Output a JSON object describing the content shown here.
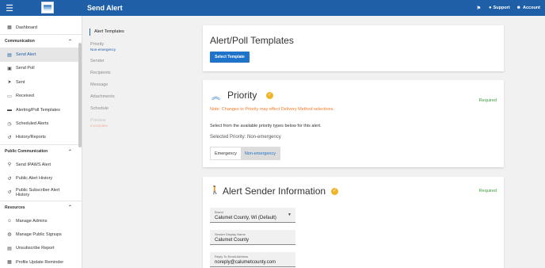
{
  "topbar": {
    "title": "Send Alert",
    "support_label": "Support",
    "account_label": "Account",
    "color": "#1f5fa8"
  },
  "sidebar": {
    "dashboard": "Dashboard",
    "sections": {
      "communication": "Communication",
      "public_communication": "Public Communication",
      "resources": "Resources"
    },
    "communication_items": [
      {
        "label": "Send Alert",
        "icon": "chat-icon"
      },
      {
        "label": "Send Poll",
        "icon": "poll-icon"
      },
      {
        "label": "Sent",
        "icon": "send-icon"
      },
      {
        "label": "Received",
        "icon": "inbox-icon"
      },
      {
        "label": "Alerting/Poll Templates",
        "icon": "folder-icon"
      },
      {
        "label": "Scheduled Alerts",
        "icon": "clock-icon"
      },
      {
        "label": "History/Reports",
        "icon": "history-icon"
      }
    ],
    "public_items": [
      {
        "label": "Send IPAWS Alert",
        "icon": "broadcast-icon"
      },
      {
        "label": "Public Alert History",
        "icon": "history-icon"
      },
      {
        "label": "Public Subscriber Alert History",
        "icon": "history-icon"
      }
    ],
    "resource_items": [
      {
        "label": "Manage Admins",
        "icon": "admin-icon"
      },
      {
        "label": "Manage Public Signups",
        "icon": "globe-icon"
      },
      {
        "label": "Unsubscribe Report",
        "icon": "report-icon"
      },
      {
        "label": "Profile Update Reminder",
        "icon": "calendar-icon"
      }
    ]
  },
  "steps": {
    "alert_templates": "Alert Templates",
    "priority": "Priority",
    "priority_value": "Non-emergency",
    "sender": "Sender",
    "recipients": "Recipients",
    "message": "Message",
    "attachments": "Attachments",
    "schedule": "Schedule",
    "preview": "Preview",
    "preview_value": "Incomplete"
  },
  "templates_card": {
    "title": "Alert/Poll Templates",
    "button": "Select Template"
  },
  "priority_card": {
    "title": "Priority",
    "required": "Required",
    "note": "Note: Changes to Priority may effect Delivery Method selections.",
    "instruction": "Select from the available priority types below for this alert.",
    "selected_text": "Selected Priority: Non-emergency",
    "options": [
      "Emergency",
      "Non-emergency"
    ],
    "selected_option": "Non-emergency"
  },
  "sender_card": {
    "title": "Alert Sender Information",
    "required": "Required",
    "brand_label": "Brand",
    "brand_value": "Calumet County, WI (Default)",
    "display_name_label": "Sender Display Name",
    "display_name_value": "Calumet County",
    "reply_label": "Reply To Email Address",
    "reply_value": "noreply@calumetcounty.com"
  },
  "colors": {
    "accent": "#1f73c9",
    "warning": "#f07a2a",
    "success": "#3a9a3a",
    "check": "#f0b429"
  }
}
